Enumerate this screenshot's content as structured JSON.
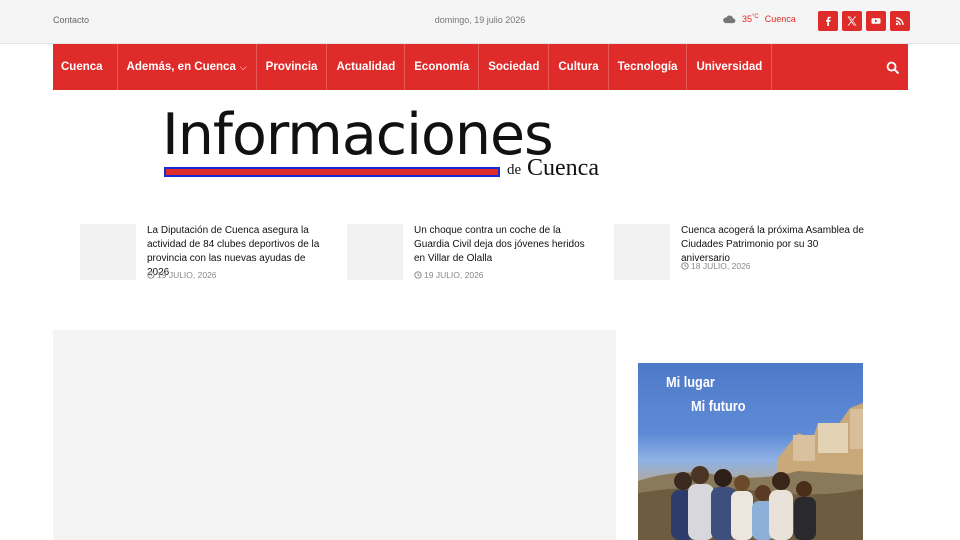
{
  "topbar": {
    "contact": "Contacto",
    "date": "domingo, 19 julio 2026",
    "weather": {
      "icon": "cloud-icon",
      "temp": "35",
      "unit": "°C",
      "city": "Cuenca"
    },
    "socials": [
      {
        "name": "facebook-icon"
      },
      {
        "name": "x-icon"
      },
      {
        "name": "youtube-icon"
      },
      {
        "name": "rss-icon"
      }
    ]
  },
  "nav": {
    "items": [
      {
        "label": "Cuenca"
      },
      {
        "label": "Además, en Cuenca",
        "has_dropdown": true
      },
      {
        "label": "Provincia"
      },
      {
        "label": "Actualidad"
      },
      {
        "label": "Economía"
      },
      {
        "label": "Sociedad"
      },
      {
        "label": "Cultura"
      },
      {
        "label": "Tecnología"
      },
      {
        "label": "Universidad"
      }
    ],
    "search_icon": "search-icon"
  },
  "logo": {
    "word": "Informaciones",
    "de": "de",
    "city": "Cuenca"
  },
  "trending": [
    {
      "title": "La Diputación de Cuenca asegura la actividad de 84 clubes deportivos de la provincia con las nuevas ayudas de 2026",
      "date": "19 JULIO, 2026"
    },
    {
      "title": "Un choque contra un coche de la Guardia Civil deja dos jóvenes heridos en Villar de Olalla",
      "date": "19 JULIO, 2026"
    },
    {
      "title": "Cuenca acogerá la próxima Asamblea de Ciudades Patrimonio por su 30 aniversario",
      "date": "18 JULIO, 2026"
    }
  ],
  "ad": {
    "line1": "Mi lugar",
    "line2": "Mi futuro"
  },
  "colors": {
    "accent": "#e02b2b",
    "logo_bar_border": "#1a2bd6"
  }
}
